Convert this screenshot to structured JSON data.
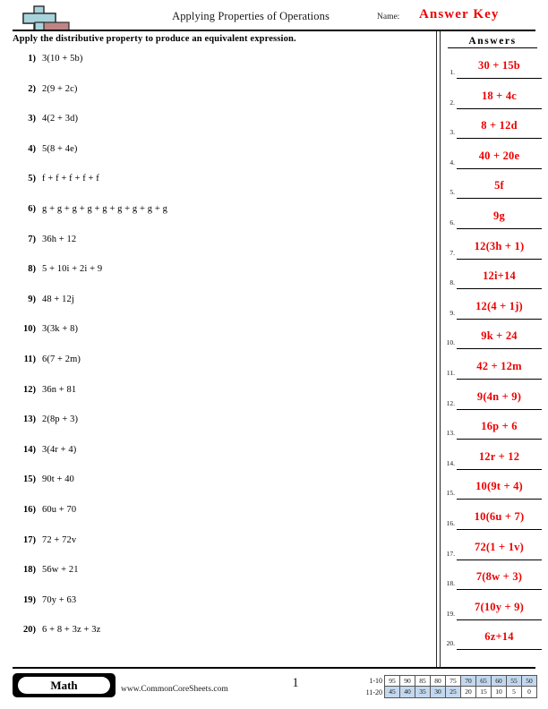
{
  "header": {
    "title": "Applying Properties of Operations",
    "name_label": "Name:",
    "answer_key": "Answer Key",
    "logo_icon": "plus-block-logo"
  },
  "instructions": "Apply the distributive property to produce an equivalent expression.",
  "problems": [
    {
      "number": "1)",
      "text": "3(10 + 5b)"
    },
    {
      "number": "2)",
      "text": "2(9 + 2c)"
    },
    {
      "number": "3)",
      "text": "4(2 + 3d)"
    },
    {
      "number": "4)",
      "text": "5(8 + 4e)"
    },
    {
      "number": "5)",
      "text": "f + f + f + f + f"
    },
    {
      "number": "6)",
      "text": "g + g + g + g + g + g + g + g + g"
    },
    {
      "number": "7)",
      "text": "36h + 12"
    },
    {
      "number": "8)",
      "text": "5 + 10i + 2i + 9"
    },
    {
      "number": "9)",
      "text": "48 + 12j"
    },
    {
      "number": "10)",
      "text": "3(3k + 8)"
    },
    {
      "number": "11)",
      "text": "6(7 + 2m)"
    },
    {
      "number": "12)",
      "text": "36n + 81"
    },
    {
      "number": "13)",
      "text": "2(8p + 3)"
    },
    {
      "number": "14)",
      "text": "3(4r + 4)"
    },
    {
      "number": "15)",
      "text": "90t + 40"
    },
    {
      "number": "16)",
      "text": "60u + 70"
    },
    {
      "number": "17)",
      "text": "72 + 72v"
    },
    {
      "number": "18)",
      "text": "56w + 21"
    },
    {
      "number": "19)",
      "text": "70y + 63"
    },
    {
      "number": "20)",
      "text": "6 + 8 + 3z + 3z"
    }
  ],
  "answers_panel": {
    "heading": "Answers",
    "answer_color": "#ee0000",
    "items": [
      {
        "number": "1.",
        "value": "30 + 15b"
      },
      {
        "number": "2.",
        "value": "18 + 4c"
      },
      {
        "number": "3.",
        "value": "8 + 12d"
      },
      {
        "number": "4.",
        "value": "40 + 20e"
      },
      {
        "number": "5.",
        "value": "5f"
      },
      {
        "number": "6.",
        "value": "9g"
      },
      {
        "number": "7.",
        "value": "12(3h + 1)"
      },
      {
        "number": "8.",
        "value": "12i+14"
      },
      {
        "number": "9.",
        "value": "12(4 + 1j)"
      },
      {
        "number": "10.",
        "value": "9k + 24"
      },
      {
        "number": "11.",
        "value": "42 + 12m"
      },
      {
        "number": "12.",
        "value": "9(4n + 9)"
      },
      {
        "number": "13.",
        "value": "16p + 6"
      },
      {
        "number": "14.",
        "value": "12r + 12"
      },
      {
        "number": "15.",
        "value": "10(9t + 4)"
      },
      {
        "number": "16.",
        "value": "10(6u + 7)"
      },
      {
        "number": "17.",
        "value": "72(1 + 1v)"
      },
      {
        "number": "18.",
        "value": "7(8w + 3)"
      },
      {
        "number": "19.",
        "value": "7(10y + 9)"
      },
      {
        "number": "20.",
        "value": "6z+14"
      }
    ]
  },
  "footer": {
    "subject_badge": "Math",
    "website": "www.CommonCoreSheets.com",
    "page_number": "1"
  },
  "score_table": {
    "highlight_color": "#c3d8ef",
    "rows": [
      {
        "label": "1-10",
        "cells": [
          {
            "value": "95",
            "highlighted": false
          },
          {
            "value": "90",
            "highlighted": false
          },
          {
            "value": "85",
            "highlighted": false
          },
          {
            "value": "80",
            "highlighted": false
          },
          {
            "value": "75",
            "highlighted": false
          },
          {
            "value": "70",
            "highlighted": true
          },
          {
            "value": "65",
            "highlighted": true
          },
          {
            "value": "60",
            "highlighted": true
          },
          {
            "value": "55",
            "highlighted": true
          },
          {
            "value": "50",
            "highlighted": true
          }
        ]
      },
      {
        "label": "11-20",
        "cells": [
          {
            "value": "45",
            "highlighted": true
          },
          {
            "value": "40",
            "highlighted": true
          },
          {
            "value": "35",
            "highlighted": true
          },
          {
            "value": "30",
            "highlighted": true
          },
          {
            "value": "25",
            "highlighted": true
          },
          {
            "value": "20",
            "highlighted": false
          },
          {
            "value": "15",
            "highlighted": false
          },
          {
            "value": "10",
            "highlighted": false
          },
          {
            "value": "5",
            "highlighted": false
          },
          {
            "value": "0",
            "highlighted": false
          }
        ]
      }
    ]
  }
}
